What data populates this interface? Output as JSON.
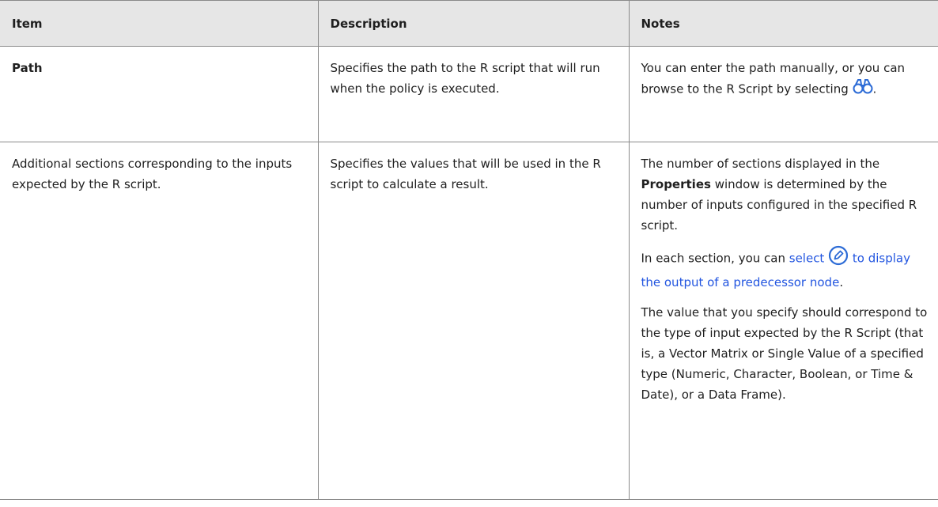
{
  "headers": {
    "item": "Item",
    "description": "Description",
    "notes": "Notes"
  },
  "rows": [
    {
      "item": "Path",
      "description": "Specifies the path to the R script that will run when the policy is executed.",
      "notes": {
        "text": "You can enter the path manually, or you can browse to the R Script by selecting",
        "icon": "binoculars-icon",
        "suffix": "."
      }
    },
    {
      "item": "Additional sections corresponding to the inputs expected by the R script.",
      "description": "Specifies the values that will be used in the R script to calculate a result.",
      "notes": {
        "p1_before": "The number of sections displayed in the ",
        "p1_bold": "Properties",
        "p1_after": " window is determined by the number of inputs configured in the specified R script.",
        "p2_before": "In each section, you can ",
        "p2_link_a": "select",
        "p2_icon": "pencil-circle-icon",
        "p2_link_b": "to display the output of a predecessor node",
        "p2_after": ".",
        "p3": "The value that you specify should correspond to the type of input expected by the R Script (that is, a Vector Matrix or Single Value of a specified type (Numeric, Character, Boolean, or Time & Date), or a Data Frame)."
      }
    }
  ],
  "colors": {
    "header_bg": "#e6e6e6",
    "border": "#8a8a8a",
    "link": "#2255e0",
    "icon_blue": "#2c6bd6"
  }
}
